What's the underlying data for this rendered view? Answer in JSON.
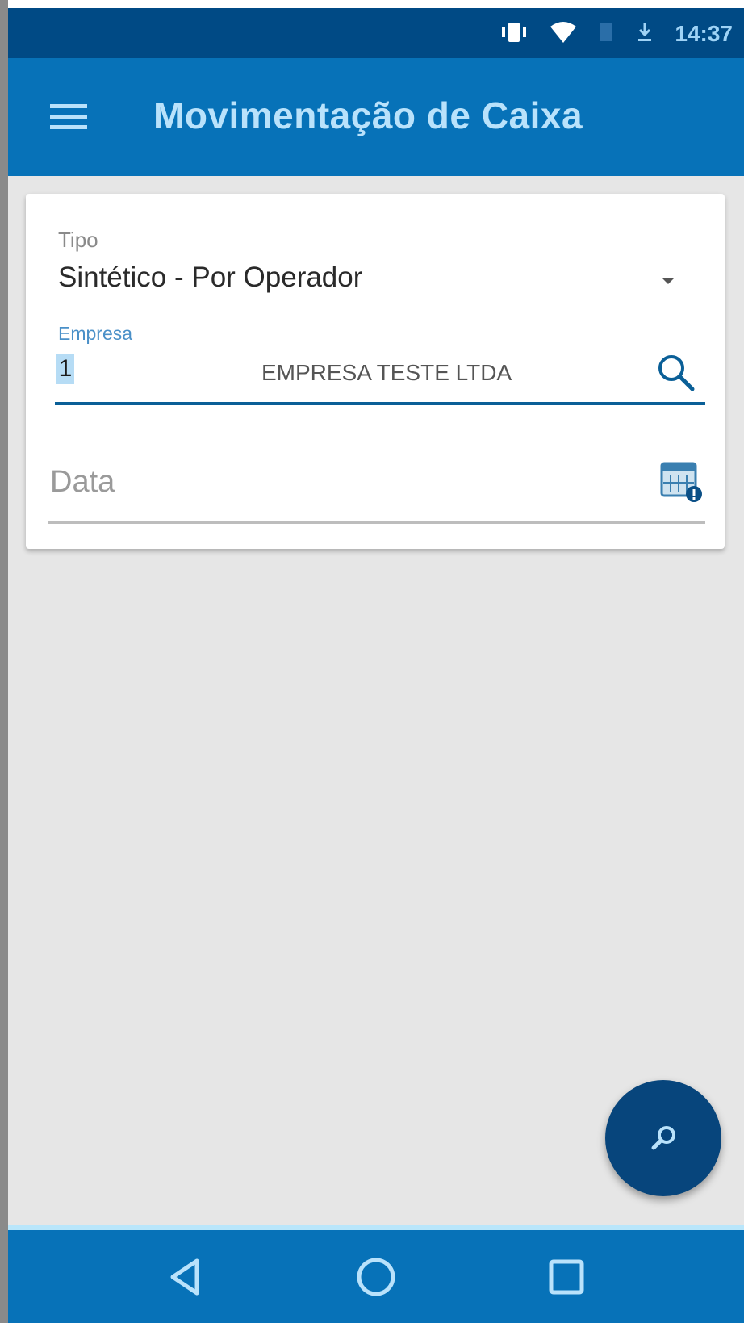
{
  "status_bar": {
    "time": "14:37",
    "icons": [
      "vibrate-icon",
      "wifi-icon",
      "signal-icon",
      "download-icon"
    ]
  },
  "app_bar": {
    "title": "Movimentação de Caixa",
    "menu_icon": "hamburger-menu-icon"
  },
  "form": {
    "tipo": {
      "label": "Tipo",
      "selected": "Sintético - Por Operador"
    },
    "empresa": {
      "label": "Empresa",
      "code": "1",
      "name": "EMPRESA TESTE LTDA",
      "search_icon": "search-icon"
    },
    "data": {
      "placeholder": "Data",
      "value": "",
      "calendar_icon": "calendar-icon"
    }
  },
  "fab": {
    "icon": "search-icon"
  },
  "nav_bar": {
    "buttons": [
      "back-icon",
      "home-icon",
      "recents-icon"
    ]
  },
  "colors": {
    "primary": "#0772b8",
    "primary_dark": "#004a85",
    "fab": "#07457c",
    "accent_light": "#b9e2fb",
    "background": "#e6e6e6"
  }
}
